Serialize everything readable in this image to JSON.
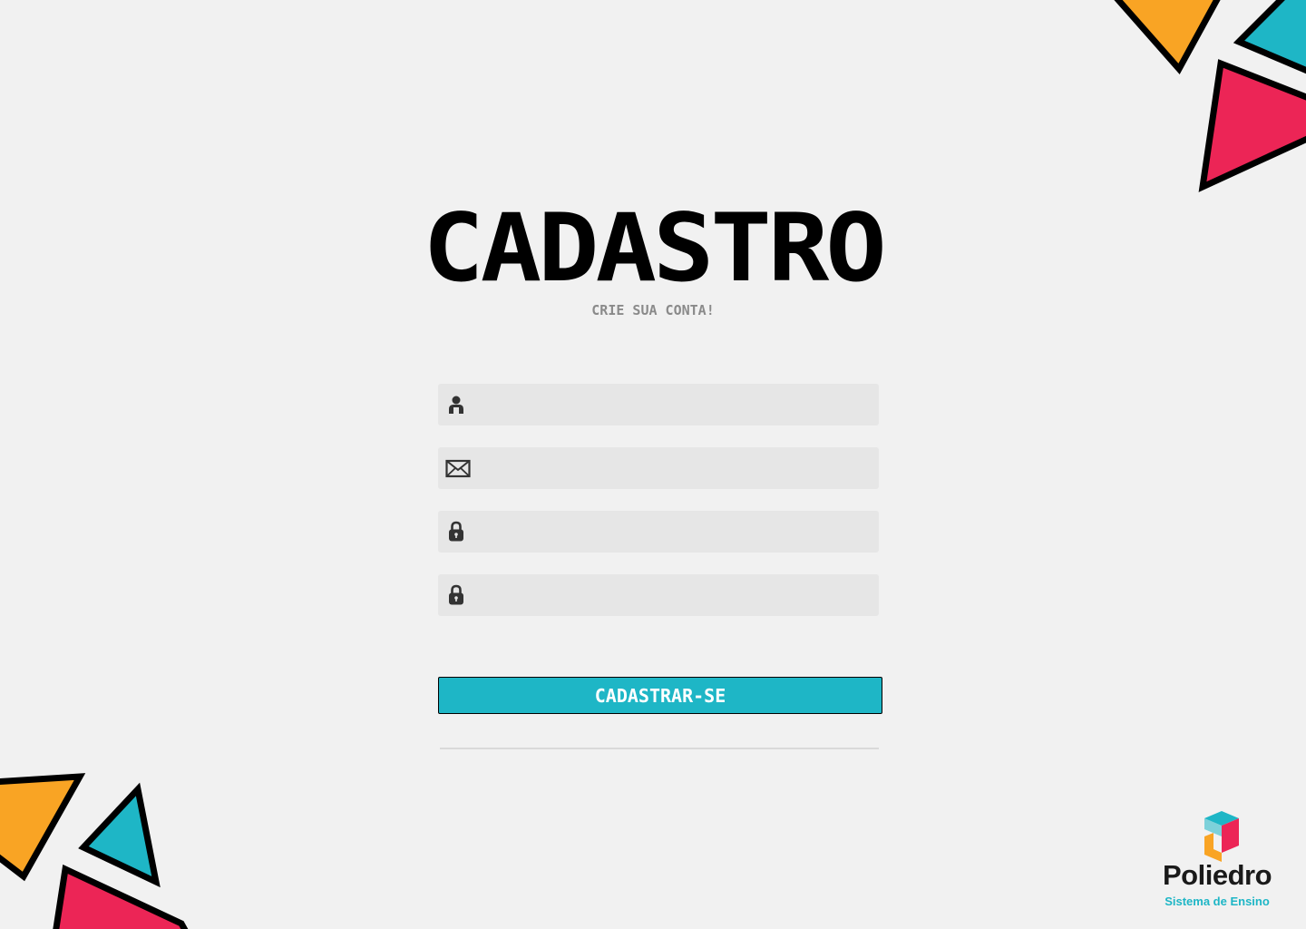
{
  "page": {
    "title": "CADASTRO",
    "subtitle": "CRIE SUA CONTA!"
  },
  "form": {
    "fields": [
      {
        "name": "name",
        "icon": "user-icon",
        "value": ""
      },
      {
        "name": "email",
        "icon": "envelope-icon",
        "value": ""
      },
      {
        "name": "password",
        "icon": "lock-icon",
        "value": ""
      },
      {
        "name": "confirm_password",
        "icon": "lock-icon",
        "value": ""
      }
    ],
    "submit_label": "CADASTRAR-SE"
  },
  "brand": {
    "name": "Poliedro",
    "tagline": "Sistema de Ensino"
  },
  "colors": {
    "background": "#f1f1f1",
    "accent": "#1eb6c6",
    "orange": "#f9a424",
    "pink": "#ec2556",
    "field": "#e6e6e6"
  }
}
